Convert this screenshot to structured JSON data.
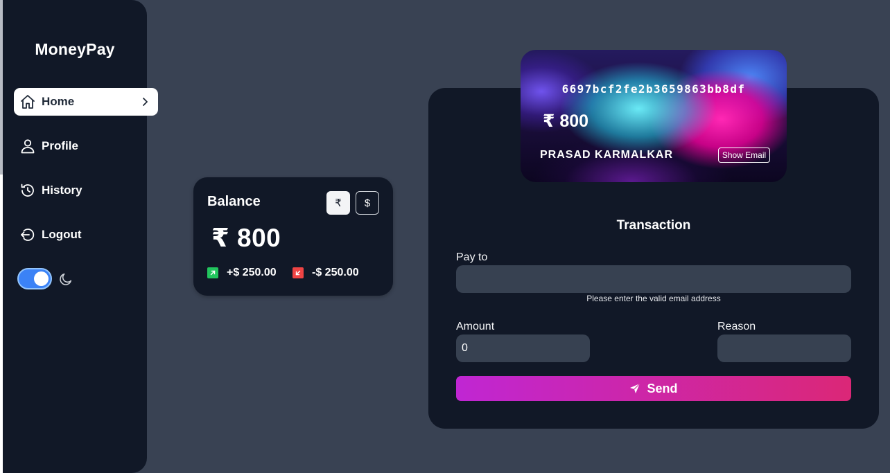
{
  "app": {
    "brand": "MoneyPay"
  },
  "sidebar": {
    "items": [
      {
        "label": "Home",
        "icon": "home-icon",
        "active": true
      },
      {
        "label": "Profile",
        "icon": "user-icon"
      },
      {
        "label": "History",
        "icon": "history-icon"
      },
      {
        "label": "Logout",
        "icon": "logout-icon"
      }
    ],
    "dark_mode": true
  },
  "balance": {
    "title": "Balance",
    "currency_rupee": "₹",
    "currency_dollar": "$",
    "amount": "₹ 800",
    "incoming": "+$ 250.00",
    "outgoing": "-$ 250.00"
  },
  "card": {
    "number": "6697bcf2fe2b3659863bb8df",
    "balance": "₹ 800",
    "holder": "PRASAD KARMALKAR",
    "show_email_label": "Show Email"
  },
  "transaction": {
    "title": "Transaction",
    "pay_to_label": "Pay to",
    "pay_to_value": "",
    "pay_to_hint": "Please enter the valid email address",
    "amount_label": "Amount",
    "amount_value": "0",
    "reason_label": "Reason",
    "reason_value": "",
    "send_label": "Send"
  },
  "colors": {
    "background": "#394253",
    "panel": "#111827",
    "input": "#374151",
    "accent_blue": "#3b82f6",
    "send_gradient_start": "#c026d3",
    "send_gradient_end": "#db2777",
    "positive": "#22c55e",
    "negative": "#ef4444"
  }
}
